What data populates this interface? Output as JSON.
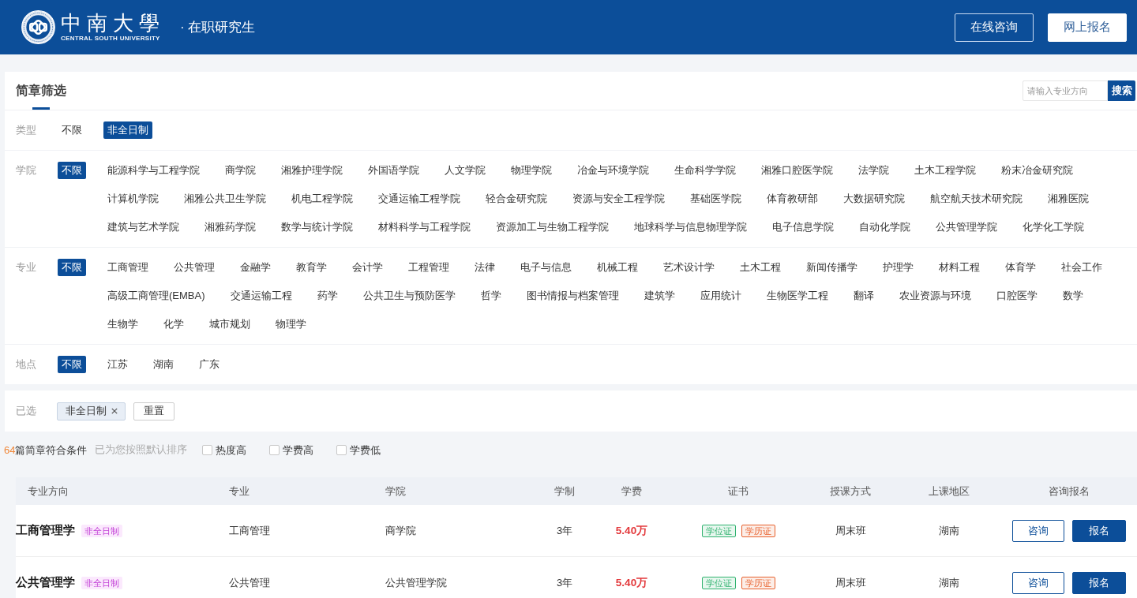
{
  "header": {
    "logo_name": "中南大學",
    "logo_subtitle": "CENTRAL SOUTH UNIVERSITY",
    "section": "· 在职研究生",
    "buttons": [
      {
        "label": "在线咨询",
        "kind": "outline"
      },
      {
        "label": "网上报名",
        "kind": "solid"
      }
    ]
  },
  "filter_panel": {
    "title": "简章筛选",
    "search": {
      "placeholder": "请输入专业方向",
      "button": "搜索"
    },
    "groups": [
      {
        "label": "类型",
        "all_option": {
          "label": "不限",
          "selected": false
        },
        "options": [
          {
            "label": "非全日制",
            "selected": true
          }
        ]
      },
      {
        "label": "学院",
        "all_option": {
          "label": "不限",
          "selected": true
        },
        "options": [
          {
            "label": "能源科学与工程学院",
            "selected": false
          },
          {
            "label": "商学院",
            "selected": false
          },
          {
            "label": "湘雅护理学院",
            "selected": false
          },
          {
            "label": "外国语学院",
            "selected": false
          },
          {
            "label": "人文学院",
            "selected": false
          },
          {
            "label": "物理学院",
            "selected": false
          },
          {
            "label": "冶金与环境学院",
            "selected": false
          },
          {
            "label": "生命科学学院",
            "selected": false
          },
          {
            "label": "湘雅口腔医学院",
            "selected": false
          },
          {
            "label": "法学院",
            "selected": false
          },
          {
            "label": "土木工程学院",
            "selected": false
          },
          {
            "label": "粉末冶金研究院",
            "selected": false
          },
          {
            "label": "计算机学院",
            "selected": false
          },
          {
            "label": "湘雅公共卫生学院",
            "selected": false
          },
          {
            "label": "机电工程学院",
            "selected": false
          },
          {
            "label": "交通运输工程学院",
            "selected": false
          },
          {
            "label": "轻合金研究院",
            "selected": false
          },
          {
            "label": "资源与安全工程学院",
            "selected": false
          },
          {
            "label": "基础医学院",
            "selected": false
          },
          {
            "label": "体育教研部",
            "selected": false
          },
          {
            "label": "大数据研究院",
            "selected": false
          },
          {
            "label": "航空航天技术研究院",
            "selected": false
          },
          {
            "label": "湘雅医院",
            "selected": false
          },
          {
            "label": "建筑与艺术学院",
            "selected": false
          },
          {
            "label": "湘雅药学院",
            "selected": false
          },
          {
            "label": "数学与统计学院",
            "selected": false
          },
          {
            "label": "材料科学与工程学院",
            "selected": false
          },
          {
            "label": "资源加工与生物工程学院",
            "selected": false
          },
          {
            "label": "地球科学与信息物理学院",
            "selected": false
          },
          {
            "label": "电子信息学院",
            "selected": false
          },
          {
            "label": "自动化学院",
            "selected": false
          },
          {
            "label": "公共管理学院",
            "selected": false
          },
          {
            "label": "化学化工学院",
            "selected": false
          }
        ]
      },
      {
        "label": "专业",
        "all_option": {
          "label": "不限",
          "selected": true
        },
        "options": [
          {
            "label": "工商管理",
            "selected": false
          },
          {
            "label": "公共管理",
            "selected": false
          },
          {
            "label": "金融学",
            "selected": false
          },
          {
            "label": "教育学",
            "selected": false
          },
          {
            "label": "会计学",
            "selected": false
          },
          {
            "label": "工程管理",
            "selected": false
          },
          {
            "label": "法律",
            "selected": false
          },
          {
            "label": "电子与信息",
            "selected": false
          },
          {
            "label": "机械工程",
            "selected": false
          },
          {
            "label": "艺术设计学",
            "selected": false
          },
          {
            "label": "土木工程",
            "selected": false
          },
          {
            "label": "新闻传播学",
            "selected": false
          },
          {
            "label": "护理学",
            "selected": false
          },
          {
            "label": "材料工程",
            "selected": false
          },
          {
            "label": "体育学",
            "selected": false
          },
          {
            "label": "社会工作",
            "selected": false
          },
          {
            "label": "高级工商管理(EMBA)",
            "selected": false
          },
          {
            "label": "交通运输工程",
            "selected": false
          },
          {
            "label": "药学",
            "selected": false
          },
          {
            "label": "公共卫生与预防医学",
            "selected": false
          },
          {
            "label": "哲学",
            "selected": false
          },
          {
            "label": "图书情报与档案管理",
            "selected": false
          },
          {
            "label": "建筑学",
            "selected": false
          },
          {
            "label": "应用统计",
            "selected": false
          },
          {
            "label": "生物医学工程",
            "selected": false
          },
          {
            "label": "翻译",
            "selected": false
          },
          {
            "label": "农业资源与环境",
            "selected": false
          },
          {
            "label": "口腔医学",
            "selected": false
          },
          {
            "label": "数学",
            "selected": false
          },
          {
            "label": "生物学",
            "selected": false
          },
          {
            "label": "化学",
            "selected": false
          },
          {
            "label": "城市规划",
            "selected": false
          },
          {
            "label": "物理学",
            "selected": false
          }
        ]
      },
      {
        "label": "地点",
        "all_option": {
          "label": "不限",
          "selected": true
        },
        "options": [
          {
            "label": "江苏",
            "selected": false
          },
          {
            "label": "湖南",
            "selected": false
          },
          {
            "label": "广东",
            "selected": false
          }
        ]
      }
    ]
  },
  "selected_bar": {
    "label": "已选",
    "chips": [
      "非全日制"
    ],
    "reset_button": "重置"
  },
  "sort_bar": {
    "count": "64",
    "count_text": "篇简章符合条件",
    "note": "已为您按照默认排序",
    "options": [
      {
        "label": "热度高",
        "checked": false
      },
      {
        "label": "学费高",
        "checked": false
      },
      {
        "label": "学费低",
        "checked": false
      }
    ]
  },
  "table": {
    "columns": [
      "专业方向",
      "专业",
      "学院",
      "学制",
      "学费",
      "证书",
      "授课方式",
      "上课地区",
      "咨询报名"
    ],
    "rows": [
      {
        "title": "工商管理学",
        "tag": "非全日制",
        "major": "工商管理",
        "college": "商学院",
        "duration": "3年",
        "fee": "5.40万",
        "certificates": [
          {
            "label": "学位证",
            "color": "#2fb26e"
          },
          {
            "label": "学历证",
            "color": "#e8602c"
          }
        ],
        "mode": "周末班",
        "region": "湖南",
        "actions": [
          {
            "label": "咨询",
            "kind": "outline"
          },
          {
            "label": "报名",
            "kind": "solid"
          }
        ]
      },
      {
        "title": "公共管理学",
        "tag": "非全日制",
        "major": "公共管理",
        "college": "公共管理学院",
        "duration": "3年",
        "fee": "5.40万",
        "certificates": [
          {
            "label": "学位证",
            "color": "#2fb26e"
          },
          {
            "label": "学历证",
            "color": "#e8602c"
          }
        ],
        "mode": "周末班",
        "region": "湖南",
        "actions": [
          {
            "label": "咨询",
            "kind": "outline"
          },
          {
            "label": "报名",
            "kind": "solid"
          }
        ]
      }
    ]
  }
}
